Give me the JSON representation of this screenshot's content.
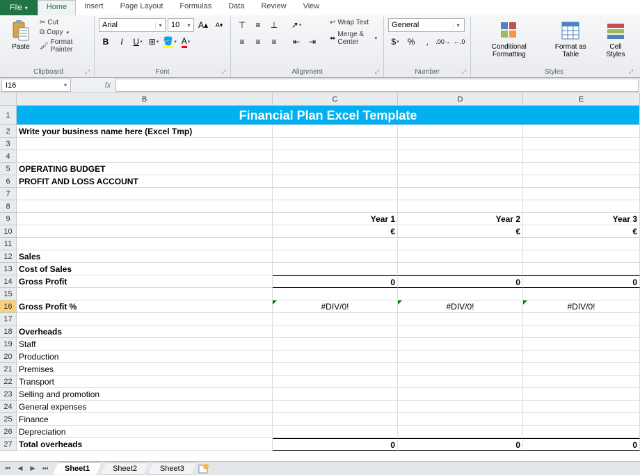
{
  "tabs": {
    "file": "File",
    "home": "Home",
    "insert": "Insert",
    "pageLayout": "Page Layout",
    "formulas": "Formulas",
    "data": "Data",
    "review": "Review",
    "view": "View"
  },
  "clipboard": {
    "paste": "Paste",
    "cut": "Cut",
    "copy": "Copy",
    "formatPainter": "Format Painter",
    "label": "Clipboard"
  },
  "font": {
    "name": "Arial",
    "size": "10",
    "label": "Font"
  },
  "alignment": {
    "wrap": "Wrap Text",
    "merge": "Merge & Center",
    "label": "Alignment"
  },
  "number": {
    "format": "General",
    "label": "Number"
  },
  "styles": {
    "cond": "Conditional Formatting",
    "table": "Format as Table",
    "cell": "Cell Styles",
    "label": "Styles"
  },
  "namebox": "I16",
  "fx": "fx",
  "cols": {
    "B": "B",
    "C": "C",
    "D": "D",
    "E": "E"
  },
  "widths": {
    "B": 368,
    "C": 180,
    "D": 180,
    "E": 168
  },
  "sheet": {
    "title": "Financial Plan Excel Template",
    "r2b": "Write your business name here (Excel Tmp)",
    "r5b": "OPERATING BUDGET",
    "r6b": "PROFIT AND LOSS ACCOUNT",
    "r9c": "Year 1",
    "r9d": "Year 2",
    "r9e": "Year 3",
    "r10c": "€",
    "r10d": "€",
    "r10e": "€",
    "r12b": "Sales",
    "r13b": "Cost of Sales",
    "r14b": "Gross Profit",
    "r14c": "0",
    "r14d": "0",
    "r14e": "0",
    "r16b": "Gross Profit %",
    "r16c": "#DIV/0!",
    "r16d": "#DIV/0!",
    "r16e": "#DIV/0!",
    "r18b": "Overheads",
    "r19b": "Staff",
    "r20b": "Production",
    "r21b": "Premises",
    "r22b": "Transport",
    "r23b": "Selling and promotion",
    "r24b": "General expenses",
    "r25b": "Finance",
    "r26b": "Depreciation",
    "r27b": "Total overheads",
    "r27c": "0",
    "r27d": "0",
    "r27e": "0"
  },
  "sheets": {
    "s1": "Sheet1",
    "s2": "Sheet2",
    "s3": "Sheet3"
  }
}
